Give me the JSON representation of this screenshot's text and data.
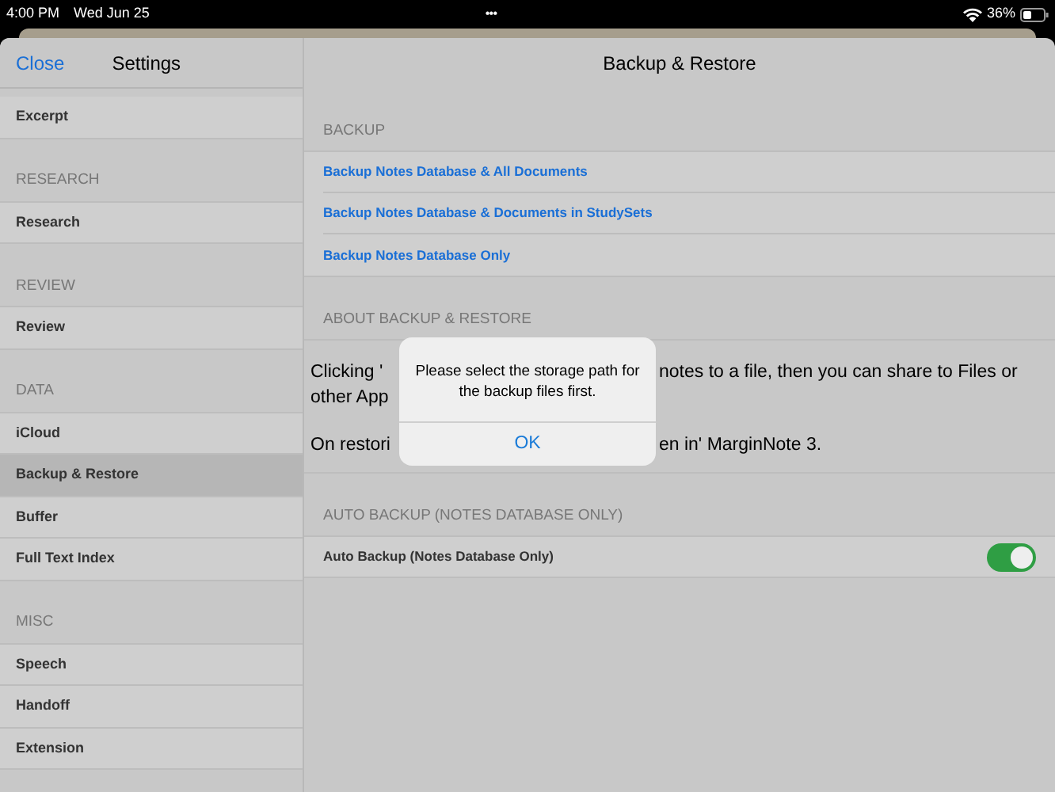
{
  "status_bar": {
    "time": "4:00 PM",
    "date": "Wed Jun 25",
    "dots": "•••",
    "battery": "36%"
  },
  "sidebar": {
    "close": "Close",
    "title": "Settings",
    "sections": [
      {
        "items": [
          {
            "label": "Excerpt",
            "selected": false
          }
        ]
      },
      {
        "header": "RESEARCH",
        "items": [
          {
            "label": "Research",
            "selected": false
          }
        ]
      },
      {
        "header": "REVIEW",
        "items": [
          {
            "label": "Review",
            "selected": false
          }
        ]
      },
      {
        "header": "DATA",
        "items": [
          {
            "label": "iCloud",
            "selected": false
          },
          {
            "label": "Backup & Restore",
            "selected": true
          },
          {
            "label": "Buffer",
            "selected": false
          },
          {
            "label": "Full Text Index",
            "selected": false
          }
        ]
      },
      {
        "header": "MISC",
        "items": [
          {
            "label": "Speech",
            "selected": false
          },
          {
            "label": "Handoff",
            "selected": false
          },
          {
            "label": "Extension",
            "selected": false
          }
        ]
      }
    ]
  },
  "detail": {
    "title": "Backup & Restore",
    "backup": {
      "header": "BACKUP",
      "actions": [
        "Backup Notes Database & All Documents",
        "Backup Notes Database & Documents in StudySets",
        "Backup Notes Database Only"
      ]
    },
    "about": {
      "header": "ABOUT BACKUP & RESTORE",
      "lines": [
        {
          "left": "Clicking '",
          "right": "notes to a file, then you can share to Files or"
        },
        {
          "left": "other App"
        },
        {
          "left": "On restori",
          "right": "en in' MarginNote 3."
        }
      ]
    },
    "auto": {
      "header": "AUTO BACKUP (NOTES DATABASE ONLY)",
      "label": "Auto Backup (Notes Database Only)",
      "on": true
    }
  },
  "alert": {
    "message": "Please select the storage path for the backup files first.",
    "button": "OK"
  }
}
